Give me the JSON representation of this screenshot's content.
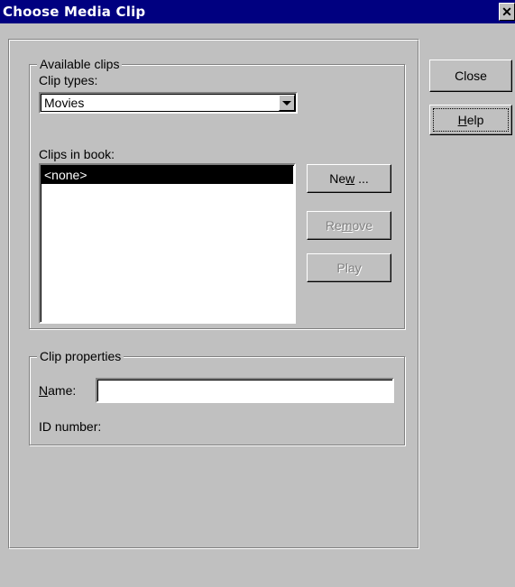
{
  "window": {
    "title": "Choose Media Clip",
    "close_glyph": "✕"
  },
  "available_clips": {
    "legend": "Available clips",
    "clip_types_label": "Clip types:",
    "clip_types_value": "Movies",
    "clips_in_book_label": "Clips in book:",
    "clips": [
      "<none>"
    ],
    "selected_index": 0
  },
  "buttons": {
    "new": {
      "pre": "Ne",
      "mnemonic": "w",
      "post": " ..."
    },
    "remove": {
      "pre": "Re",
      "mnemonic": "m",
      "post": "ove"
    },
    "play": "Play",
    "close": "Close",
    "help": {
      "pre": "",
      "mnemonic": "H",
      "post": "elp"
    }
  },
  "clip_properties": {
    "legend": "Clip properties",
    "name_label": {
      "pre": "",
      "mnemonic": "N",
      "post": "ame:"
    },
    "name_value": "",
    "id_label": "ID number:",
    "id_value": ""
  },
  "colors": {
    "titlebar": "#000080",
    "face": "#c0c0c0",
    "disabled_text": "#808080"
  }
}
